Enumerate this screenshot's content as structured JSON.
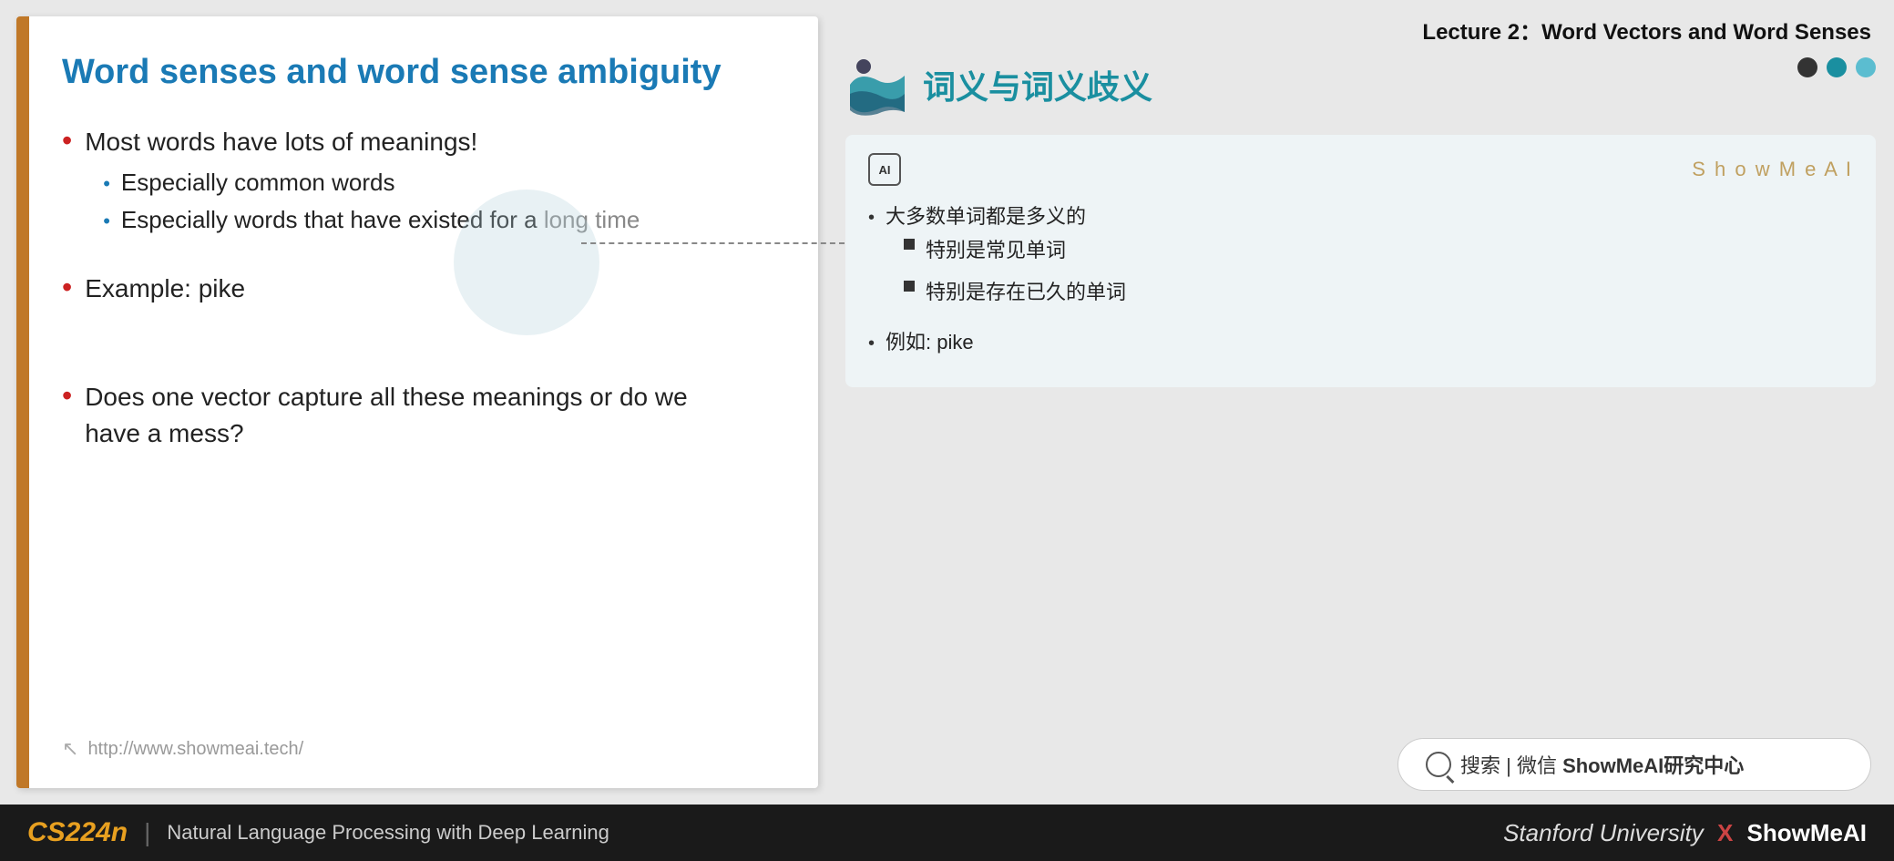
{
  "lecture": {
    "title": "Lecture 2：Word Vectors and Word Senses"
  },
  "slide": {
    "title": "Word senses and word sense ambiguity",
    "bullets": [
      {
        "text": "Most words have lots of meanings!",
        "sub_bullets": [
          {
            "text": "Especially common words"
          },
          {
            "text_before": "Especially words that have existed for a ",
            "text_highlight": "long time",
            "text_after": ""
          }
        ]
      },
      {
        "text": "Example: pike",
        "sub_bullets": []
      },
      {
        "text": "Does one vector capture all these meanings or do we have a mess?",
        "sub_bullets": []
      }
    ],
    "footer_link": "http://www.showmeai.tech/"
  },
  "chinese_panel": {
    "title": "词义与词义歧义",
    "ai_icon_label": "AI",
    "showmeai_brand": "S h o w M e A I",
    "translation_box": {
      "main_bullets": [
        {
          "text": "大多数单词都是多义的",
          "sub_bullets": [
            "特别是常见单词",
            "特别是存在已久的单词"
          ]
        },
        {
          "text": "例如: pike",
          "sub_bullets": []
        }
      ]
    },
    "dots": [
      "dark",
      "teal",
      "teal-light"
    ]
  },
  "search_bar": {
    "placeholder": "搜索 | 微信 ShowMeAI研究中心",
    "icon_label": "search"
  },
  "bottom_bar": {
    "course_code": "CS224n",
    "divider": "|",
    "course_name": "Natural Language Processing with Deep Learning",
    "right_text_italic": "Stanford University",
    "x": "X",
    "right_brand": "ShowMeAI"
  }
}
